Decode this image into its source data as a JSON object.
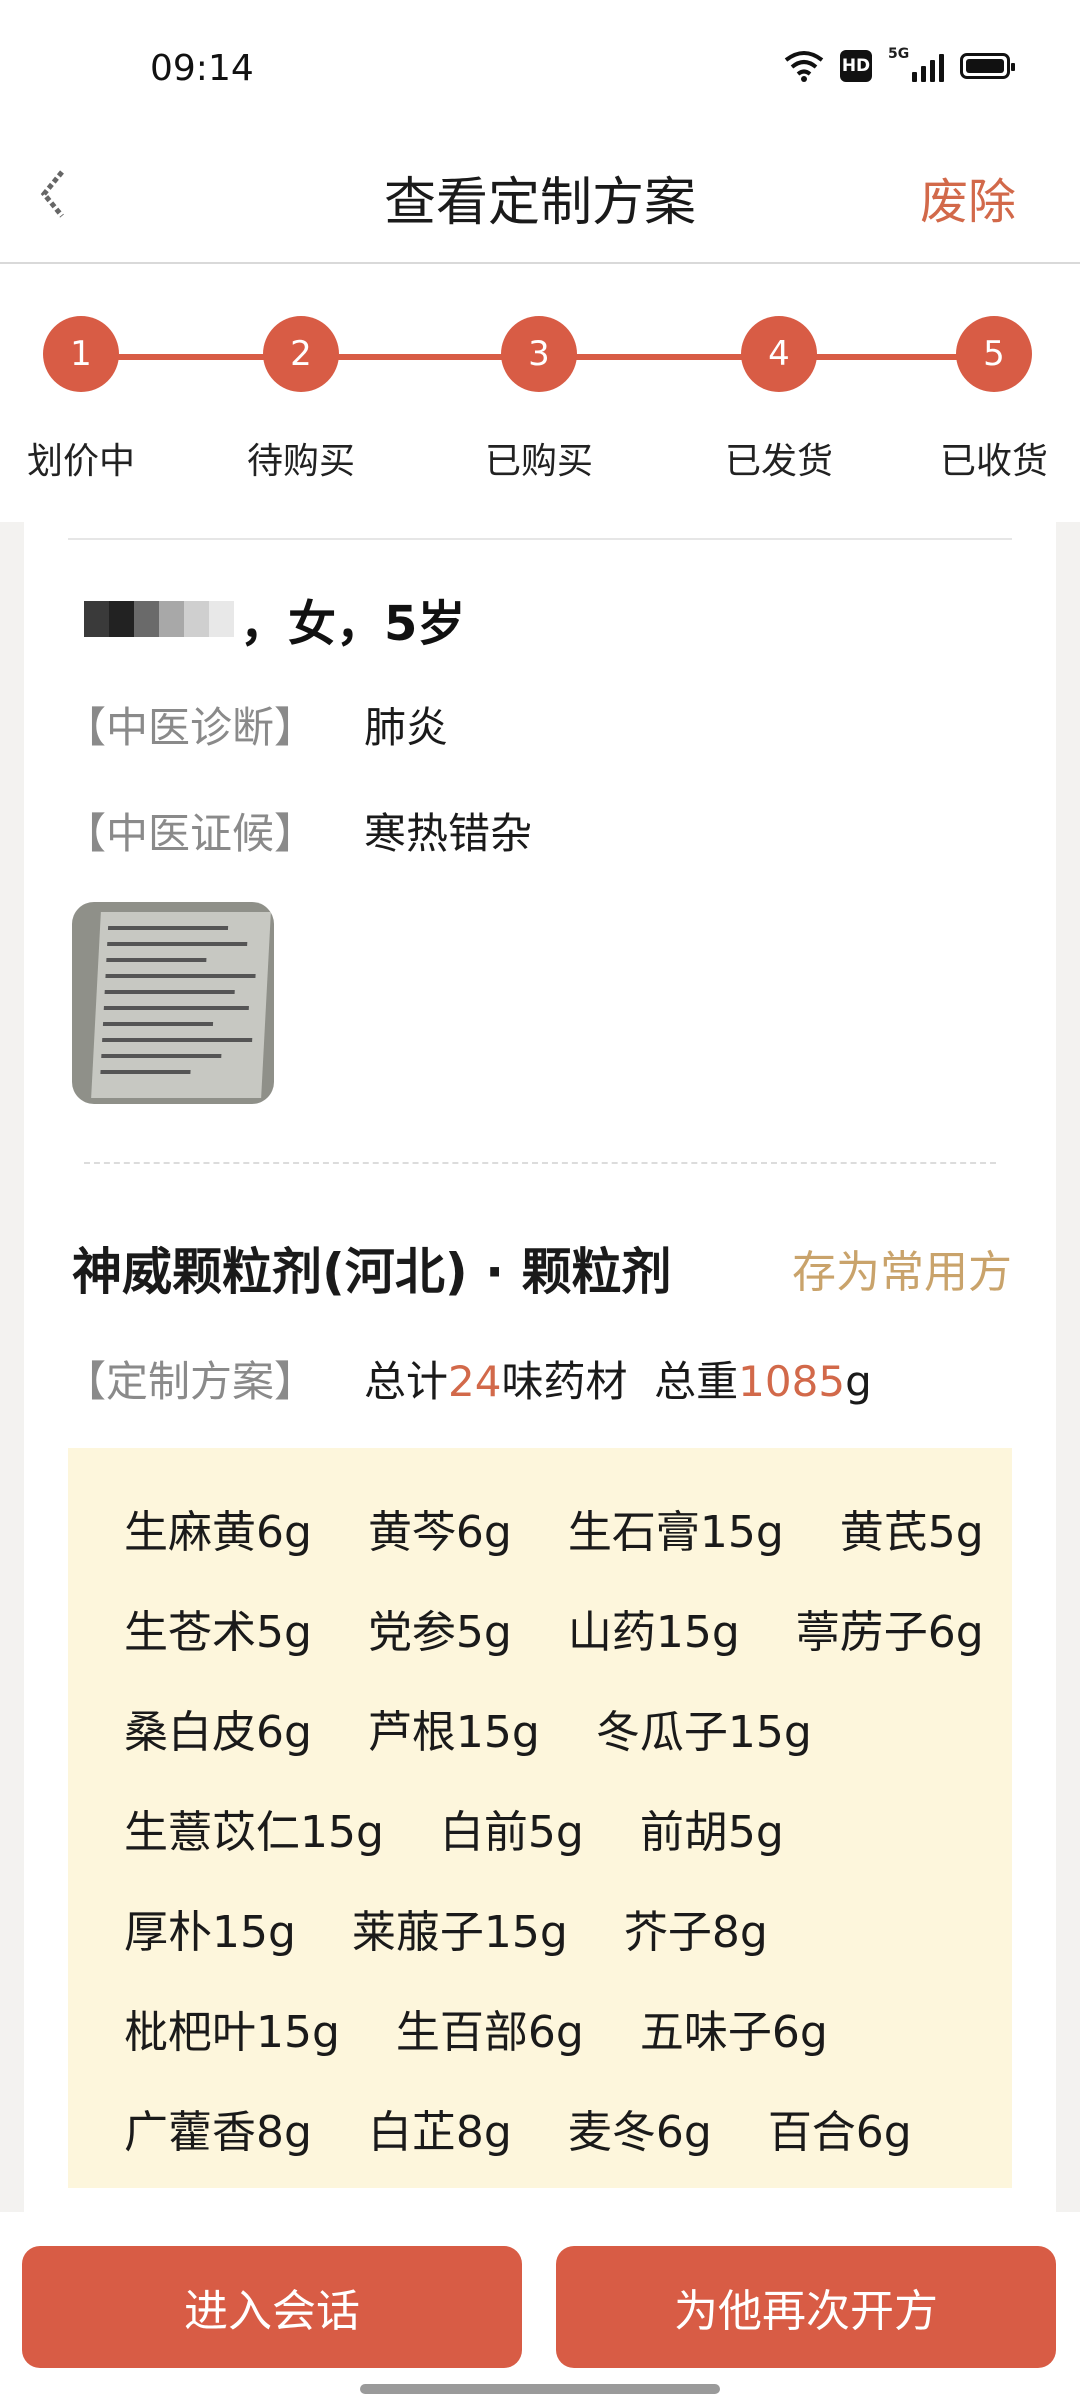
{
  "status_bar": {
    "time": "09:14",
    "hd": "HD",
    "network": "5G"
  },
  "header": {
    "title": "查看定制方案",
    "abolish": "废除"
  },
  "steps": [
    {
      "num": "1",
      "label": "划价中"
    },
    {
      "num": "2",
      "label": "待购买"
    },
    {
      "num": "3",
      "label": "已购买"
    },
    {
      "num": "4",
      "label": "已发货"
    },
    {
      "num": "5",
      "label": "已收货"
    }
  ],
  "patient": {
    "info": "，女，5岁"
  },
  "diagnosis": {
    "label": "【中医诊断】",
    "value": "肺炎"
  },
  "syndrome": {
    "label": "【中医证候】",
    "value": "寒热错杂"
  },
  "product": {
    "name": "神威颗粒剂(河北) · 颗粒剂",
    "save": "存为常用方"
  },
  "plan": {
    "label": "【定制方案】",
    "prefix": "总计",
    "count": "24",
    "mid": "味药材  总重",
    "weight": "1085",
    "unit": "g"
  },
  "herbs": [
    [
      "生麻黄6g",
      "黄芩6g",
      "生石膏15g",
      "黄芪5g"
    ],
    [
      "生苍术5g",
      "党参5g",
      "山药15g",
      "葶苈子6g"
    ],
    [
      "桑白皮6g",
      "芦根15g",
      "冬瓜子15g"
    ],
    [
      "生薏苡仁15g",
      "白前5g",
      "前胡5g"
    ],
    [
      "厚朴15g",
      "莱菔子15g",
      "芥子8g"
    ],
    [
      "枇杷叶15g",
      "生百部6g",
      "五味子6g"
    ],
    [
      "广藿香8g",
      "白芷8g",
      "麦冬6g",
      "百合6g"
    ]
  ],
  "buttons": {
    "chat": "进入会话",
    "represcribe": "为他再次开方"
  },
  "colors": {
    "accent": "#d85c45",
    "gold": "#c9a36b",
    "highlight_bg": "#fdf6dc"
  }
}
